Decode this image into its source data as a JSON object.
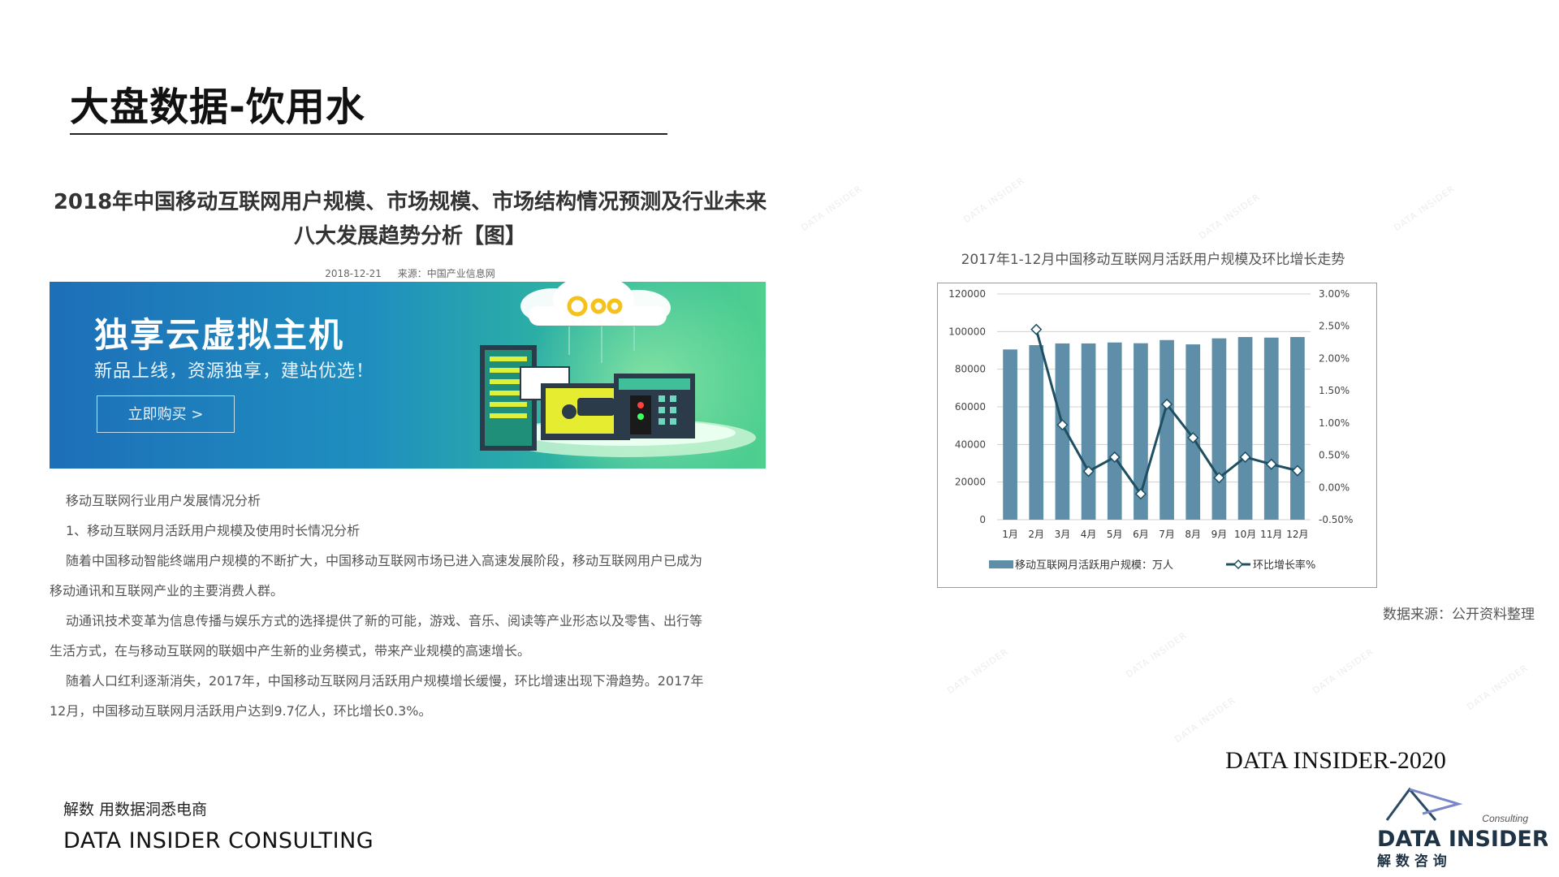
{
  "slide": {
    "title": "大盘数据-饮用水"
  },
  "article": {
    "title_line1": "2018年中国移动互联网用户规模、市场规模、市场结构情况预测及行业未来",
    "title_line2": "八大发展趋势分析【图】",
    "date": "2018-12-21",
    "source": "来源：中国产业信息网",
    "banner": {
      "headline": "独享云虚拟主机",
      "subline": "新品上线，资源独享，建站优选！",
      "button": "立即购买 >"
    },
    "paragraphs": [
      "移动互联网行业用户发展情况分析",
      "1、移动互联网月活跃用户规模及使用时长情况分析",
      "随着中国移动智能终端用户规模的不断扩大，中国移动互联网市场已进入高速发展阶段，移动互联网用户已成为",
      "移动通讯和互联网产业的主要消费人群。",
      "动通讯技术变革为信息传播与娱乐方式的选择提供了新的可能，游戏、音乐、阅读等产业形态以及零售、出行等",
      "生活方式，在与移动互联网的联姻中产生新的业务模式，带来产业规模的高速增长。",
      "随着人口红利逐渐消失，2017年，中国移动互联网月活跃用户规模增长缓慢，环比增速出现下滑趋势。2017年",
      "12月，中国移动互联网月活跃用户达到9.7亿人，环比增长0.3%。"
    ]
  },
  "chart_data": {
    "type": "bar",
    "title": "2017年1-12月中国移动互联网月活跃用户规模及环比增长走势",
    "categories": [
      "1月",
      "2月",
      "3月",
      "4月",
      "5月",
      "6月",
      "7月",
      "8月",
      "9月",
      "10月",
      "11月",
      "12月"
    ],
    "series": [
      {
        "name": "移动互联网月活跃用户规模：万人",
        "type": "bar",
        "axis": "left",
        "values": [
          90500,
          92800,
          93700,
          93700,
          94200,
          93800,
          95500,
          93200,
          96400,
          97100,
          96800,
          97100
        ]
      },
      {
        "name": "环比增长率%",
        "type": "line",
        "axis": "right",
        "values": [
          null,
          2.45,
          0.97,
          0.25,
          0.47,
          -0.1,
          1.29,
          0.77,
          0.15,
          0.47,
          0.36,
          0.26
        ]
      }
    ],
    "left_axis": {
      "min": 0,
      "max": 120000,
      "ticks": [
        "0",
        "20000",
        "40000",
        "60000",
        "80000",
        "100000",
        "120000"
      ]
    },
    "right_axis": {
      "min": -0.5,
      "max": 3.0,
      "ticks": [
        "-0.50%",
        "0.00%",
        "0.50%",
        "1.00%",
        "1.50%",
        "2.00%",
        "2.50%",
        "3.00%"
      ]
    },
    "grid": true,
    "legend": "bottom",
    "colors": {
      "bar": "#5f8ea8",
      "line": "#1f4f63"
    }
  },
  "data_source": "数据来源：公开资料整理",
  "brand": {
    "year_label": "DATA INSIDER-2020",
    "tagline": "解数 用数据洞悉电商",
    "company": "DATA INSIDER CONSULTING",
    "logo_consulting": "Consulting",
    "logo_name": "DATA INSIDER",
    "logo_cn": "解 数 咨 询"
  },
  "watermark": "DATA INSIDER"
}
